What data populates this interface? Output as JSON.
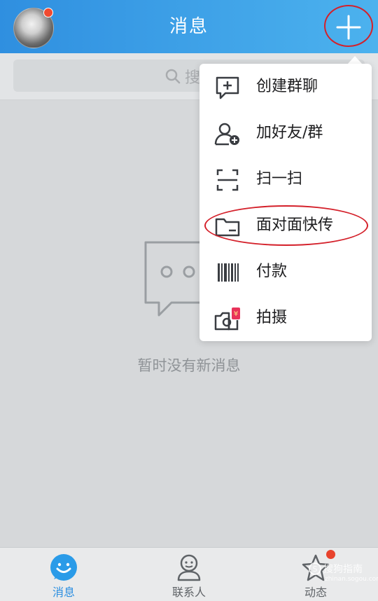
{
  "header": {
    "title": "消息",
    "avatar_badge": true
  },
  "search": {
    "placeholder": "搜"
  },
  "empty_state": {
    "text": "暂时没有新消息"
  },
  "popup_menu": {
    "items": [
      {
        "label": "创建群聊",
        "icon": "group-chat-add-icon"
      },
      {
        "label": "加好友/群",
        "icon": "add-friend-icon"
      },
      {
        "label": "扫一扫",
        "icon": "scan-icon"
      },
      {
        "label": "面对面快传",
        "icon": "folder-transfer-icon"
      },
      {
        "label": "付款",
        "icon": "barcode-pay-icon"
      },
      {
        "label": "拍摄",
        "icon": "camera-icon"
      }
    ]
  },
  "tabbar": {
    "tabs": [
      {
        "label": "消息",
        "icon": "chat-smile-icon",
        "active": true
      },
      {
        "label": "联系人",
        "icon": "contact-person-icon",
        "active": false
      },
      {
        "label": "动态",
        "icon": "star-icon",
        "active": false,
        "badge": true
      }
    ]
  },
  "watermark": {
    "text": "搜狗指南",
    "sub": "zhinan.sogou.com"
  },
  "colors": {
    "header_start": "#2f8fe0",
    "header_end": "#4cb2ee",
    "annotation_red": "#d4202a",
    "active_tab": "#2a8ee0",
    "badge_red": "#f04a2f"
  }
}
